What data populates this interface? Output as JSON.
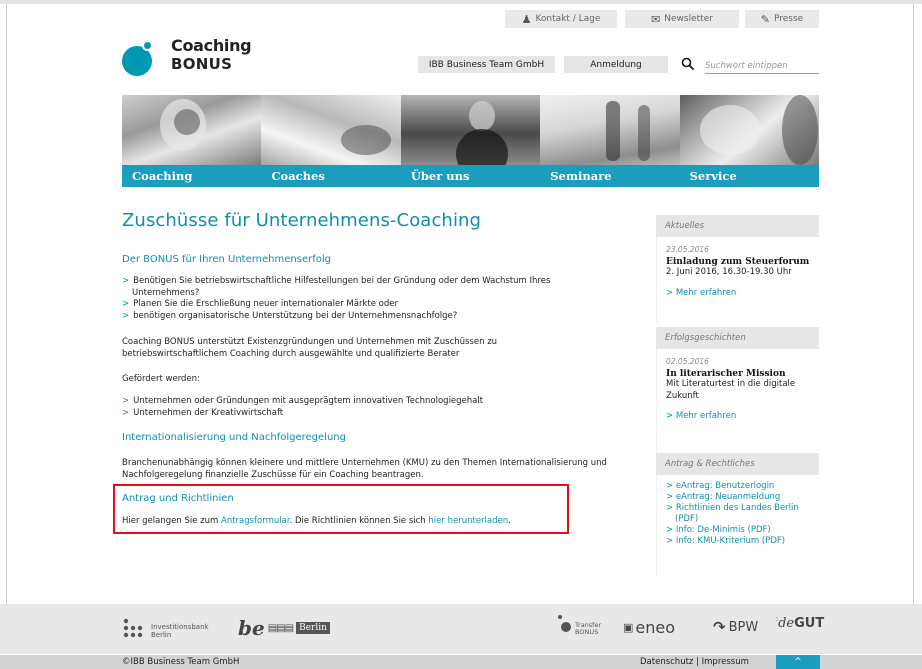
{
  "util": {
    "kontakt": "Kontakt / Lage",
    "newsletter": "Newsletter",
    "presse": "Presse"
  },
  "logo": {
    "line1": "Coaching",
    "line2": "BONUS"
  },
  "header": {
    "ibb_button": "IBB Business Team GmbH",
    "anmeldung_button": "Anmeldung",
    "search_placeholder": "Suchwort eintippen"
  },
  "nav": [
    "Coaching",
    "Coaches",
    "Über uns",
    "Seminare",
    "Service"
  ],
  "main": {
    "title": "Zuschüsse für Unternehmens-Coaching",
    "sec1_heading": "Der BONUS für Ihren Unternehmenserfolg",
    "sec1_bullets": [
      "Benötigen Sie betriebswirtschaftliche Hilfestellungen bei der Gründung oder dem Wachstum Ihres Unternehmens?",
      "Planen Sie die Erschließung neuer internationaler Märkte oder",
      "benötigen organisatorische Unterstützung bei der Unternehmensnachfolge?"
    ],
    "sec1_para": "Coaching BONUS unterstützt Existenzgründungen und Unternehmen mit Zuschüssen zu betriebswirtschaftlichem Coaching durch ausgewählte und qualifizierte Berater",
    "gefoerdert": "Gefördert werden:",
    "sec1_bullets2": [
      "Unternehmen oder Gründungen mit ausgeprägtem innovativen Technologiegehalt",
      "Unternehmen der Kreativwirtschaft"
    ],
    "sec2_heading": "Internationalisierung und Nachfolgeregelung",
    "sec2_para": "Branchenunabhängig können kleinere und mittlere Unternehmen (KMU) zu den Themen Internationalisierung und Nachfolgeregelung finanzielle Zuschüsse für ein Coaching beantragen.",
    "sec3_heading": "Antrag und Richtlinien",
    "sec3_pre": "Hier gelangen Sie zum ",
    "sec3_link1": "Antragsformular",
    "sec3_mid": ". Die Richtlinien können Sie sich ",
    "sec3_link2": "hier herunterladen",
    "sec3_post": "."
  },
  "sidebar": {
    "aktuelles": {
      "heading": "Aktuelles",
      "date": "23.05.2016",
      "title": "Einladung zum Steuerforum",
      "text": "2. Juni 2016, 16.30-19.30 Uhr",
      "more": "> Mehr erfahren"
    },
    "erfolg": {
      "heading": "Erfolgsgeschichten",
      "date": "02.05.2016",
      "title": "In literarischer Mission",
      "text": "Mit Literaturtest in die digitale Zukunft",
      "more": "> Mehr erfahren"
    },
    "antrag": {
      "heading": "Antrag & Rechtliches",
      "links": [
        "eAntrag: Benutzerlogin",
        "eAntrag: Neuanmeldung",
        "Richtlinien des Landes Berlin (PDF)",
        "Info: De-Minimis (PDF)",
        "Info: KMU-Kriterium (PDF)"
      ]
    }
  },
  "footer": {
    "ibb_line1": "Investitionsbank",
    "ibb_line2": "Berlin",
    "be": "be",
    "berlin": "Berlin",
    "transfer_line1": "Transfer",
    "transfer_line2": "BONUS",
    "eneo": "eneo",
    "bpw": "BPW",
    "degut_pre": "de",
    "degut_post": "GUT",
    "copyright": "©IBB Business Team GmbH",
    "legal": "Datenschutz | Impressum",
    "totop": "^"
  }
}
